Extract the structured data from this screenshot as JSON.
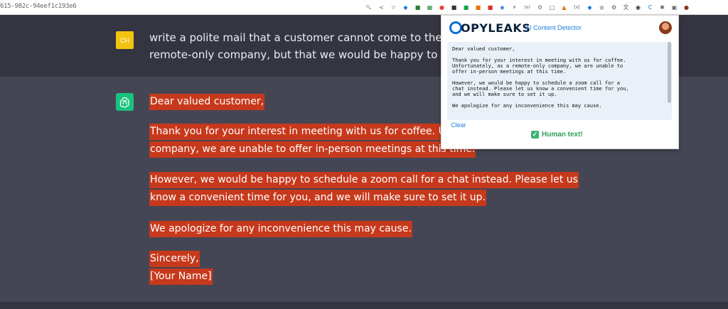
{
  "browser": {
    "url": "615-982c-94eef1c193e6",
    "toolbar_icons": [
      {
        "name": "zoom-icon",
        "glyph": "🔍",
        "color": "#5f6368"
      },
      {
        "name": "share-icon",
        "glyph": "<",
        "color": "#5f6368"
      },
      {
        "name": "bookmark-star-icon",
        "glyph": "☆",
        "color": "#5f6368"
      },
      {
        "name": "extension-diamond-icon",
        "glyph": "◆",
        "color": "#1a73e8"
      },
      {
        "name": "extension-green-icon",
        "glyph": "■",
        "color": "#2e7d32"
      },
      {
        "name": "extension-grid-icon",
        "glyph": "▦",
        "color": "#1e8e3e"
      },
      {
        "name": "extension-circle-icon",
        "glyph": "●",
        "color": "#e8453c"
      },
      {
        "name": "extension-dark-icon",
        "glyph": "■",
        "color": "#333333"
      },
      {
        "name": "extension-teal-icon",
        "glyph": "■",
        "color": "#17a34a"
      },
      {
        "name": "extension-orange-icon",
        "glyph": "■",
        "color": "#e8710a"
      },
      {
        "name": "extension-red-icon",
        "glyph": "■",
        "color": "#d93025"
      },
      {
        "name": "extension-blue-icon",
        "glyph": "◆",
        "color": "#4285f4"
      },
      {
        "name": "extension-bolt-icon",
        "glyph": "⚡",
        "color": "#333333"
      },
      {
        "name": "extension-code-icon",
        "glyph": "(o)",
        "color": "#555555"
      },
      {
        "name": "extension-gear-icon",
        "glyph": "⚙",
        "color": "#777777"
      },
      {
        "name": "extension-box-icon",
        "glyph": "▢",
        "color": "#555555"
      },
      {
        "name": "extension-fox-icon",
        "glyph": "▲",
        "color": "#e2761b"
      },
      {
        "name": "extension-bracket-icon",
        "glyph": "[x]",
        "color": "#555555"
      },
      {
        "name": "extension-blue-diamond-icon",
        "glyph": "◆",
        "color": "#1a73e8"
      },
      {
        "name": "extension-grey-circle-icon",
        "glyph": "●",
        "color": "#bdbdbd"
      },
      {
        "name": "extension-gear2-icon",
        "glyph": "⚙",
        "color": "#555555"
      },
      {
        "name": "extension-translate-icon",
        "glyph": "文",
        "color": "#555555"
      },
      {
        "name": "extension-hat-icon",
        "glyph": "◉",
        "color": "#333333"
      },
      {
        "name": "copyleaks-extension-icon",
        "glyph": "C",
        "color": "#0b6fd8"
      },
      {
        "name": "puzzle-icon",
        "glyph": "✱",
        "color": "#5f6368"
      },
      {
        "name": "side-panel-icon",
        "glyph": "▣",
        "color": "#5f6368"
      },
      {
        "name": "profile-avatar-icon",
        "glyph": "●",
        "color": "#8a3b1c"
      }
    ]
  },
  "chat": {
    "user": {
      "avatar_initials": "CH",
      "lines": [
        "write a polite mail that a customer cannot come to the office fo",
        "remote-only company,  but that we would be happy to do a zoo"
      ]
    },
    "assistant": {
      "lines": [
        "Dear valued customer,",
        "Thank you for your interest in meeting with us for coffee. Unfor",
        "company, we are unable to offer in-person meetings at this time.",
        "However, we would be happy to schedule a zoom call for a chat instead. Please let us",
        "know a convenient time for you, and we will make sure to set it up.",
        "We apologize for any inconvenience this may cause.",
        "Sincerely,",
        "[Your Name]"
      ]
    }
  },
  "copyleaks": {
    "logo": "OPYLEAKS",
    "subtitle": "AI Content Detector",
    "paragraphs": [
      "Dear valued customer,",
      "Thank you for your interest in meeting with us for coffee.\nUnfortunately, as a remote-only company, we are unable to\noffer in-person meetings at this time.",
      "However, we would be happy to schedule a zoom call for a\nchat instead. Please let us know a convenient time for you,\nand we will make sure to set it up.",
      "We apologize for any inconvenience this may cause."
    ],
    "clear_label": "Clear",
    "result_icon": "✓",
    "result_label": "Human text!"
  },
  "colors": {
    "highlight": "#c7391c",
    "user_bg": "#343541",
    "assistant_bg": "#444654",
    "gpt_green": "#19c37d",
    "user_avatar": "#f2c311",
    "copyleaks_blue": "#0b6fd8",
    "human_green": "#2e9e5b"
  }
}
